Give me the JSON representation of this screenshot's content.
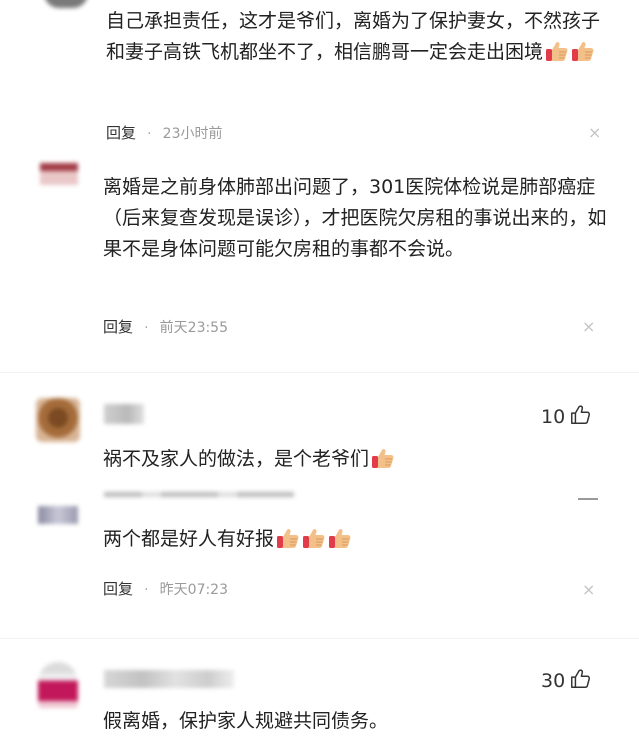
{
  "comments": [
    {
      "text": "自己承担责任，这才是爷们，离婚为了保护妻女，不然孩子和妻子高铁飞机都坐不了，相信鹏哥一定会走出困境",
      "emoji_count": 2,
      "reply_label": "回复",
      "separator": "·",
      "time": "23小时前",
      "close": "×"
    },
    {
      "text": "离婚是之前身体肺部出问题了，301医院体检说是肺部癌症（后来复查发现是误诊），才把医院欠房租的事说出来的，如果不是身体问题可能欠房租的事都不会说。",
      "reply_label": "回复",
      "separator": "·",
      "time": "前天23:55",
      "close": "×"
    },
    {
      "text": "祸不及家人的做法，是个老爷们",
      "emoji_count": 1,
      "likes": "10"
    },
    {
      "text": "两个都是好人有好报",
      "emoji_count": 3,
      "reply_label": "回复",
      "separator": "·",
      "time": "昨天07:23",
      "close": "×"
    },
    {
      "text": "假离婚，保护家人规避共同债务。",
      "likes": "30"
    }
  ],
  "icons": {
    "like": "thumbs-up-icon",
    "emoji": "thumbs-up-emoji-icon",
    "close": "close-icon"
  },
  "colors": {
    "text": "#222222",
    "meta": "#9a9a9a",
    "emoji_fill": "#f3c08a",
    "emoji_cuff": "#e23b4a"
  }
}
